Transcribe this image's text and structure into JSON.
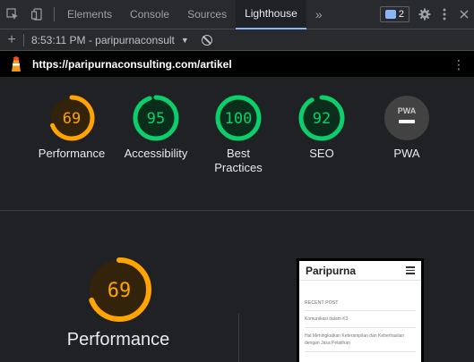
{
  "devtools": {
    "tabs": [
      "Elements",
      "Console",
      "Sources",
      "Lighthouse"
    ],
    "active_tab": "Lighthouse",
    "more_tabs": "»",
    "issues_count": "2"
  },
  "toolbar": {
    "add": "+",
    "report": "8:53:11 PM - paripurnaconsult"
  },
  "urlbar": {
    "url": "https://paripurnaconsulting.com/artikel"
  },
  "scores": [
    {
      "label": "Performance",
      "value": "69",
      "fraction": 0.69,
      "color": "#ffa400",
      "fill": "#33230a"
    },
    {
      "label": "Accessibility",
      "value": "95",
      "fraction": 0.95,
      "color": "#0cce6b",
      "fill": "#0b2e1c"
    },
    {
      "label": "Best Practices",
      "value": "100",
      "fraction": 1.0,
      "color": "#0cce6b",
      "fill": "#0b2e1c"
    },
    {
      "label": "SEO",
      "value": "92",
      "fraction": 0.92,
      "color": "#0cce6b",
      "fill": "#0b2e1c"
    }
  ],
  "pwa": {
    "label": "PWA",
    "badge": "PWA"
  },
  "performance": {
    "value": "69",
    "fraction": 0.69,
    "label": "Performance",
    "color": "#ffa400",
    "fill": "#33230a"
  },
  "thumbnail": {
    "site_title": "Paripurna",
    "recent_post": "RECENT POST",
    "items": [
      "Komunikasi dalam K3",
      "Hal Meningkatkan Keterampilan dan Keberhasilan dengan Jasa Pelatihan"
    ]
  }
}
